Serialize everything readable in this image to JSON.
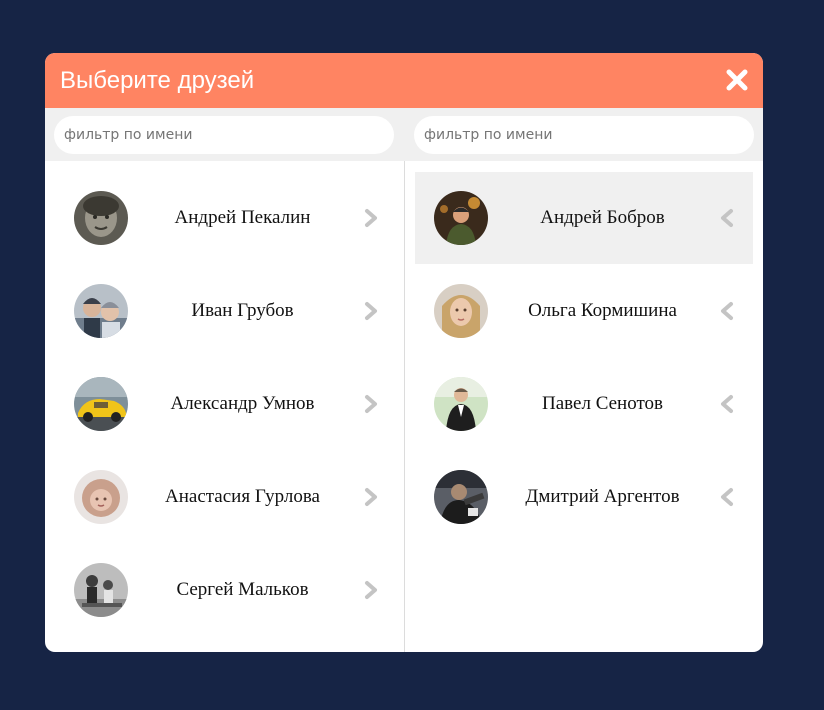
{
  "dialog": {
    "title": "Выберите друзей",
    "close_icon": "close-icon",
    "accent_color": "#ff8462",
    "background_color": "#162445"
  },
  "filters": {
    "left_placeholder": "фильтр по имени",
    "left_value": "",
    "right_placeholder": "фильтр по имени",
    "right_value": ""
  },
  "available_friends": [
    {
      "name": "Андрей Пекалин",
      "icon": "chevron-right-icon"
    },
    {
      "name": "Иван Грубов",
      "icon": "chevron-right-icon"
    },
    {
      "name": "Александр Умнов",
      "icon": "chevron-right-icon"
    },
    {
      "name": "Анастасия Гурлова",
      "icon": "chevron-right-icon"
    },
    {
      "name": "Сергей Мальков",
      "icon": "chevron-right-icon"
    }
  ],
  "selected_friends": [
    {
      "name": "Андрей Бобров",
      "icon": "chevron-left-icon",
      "highlighted": true
    },
    {
      "name": "Ольга Кормишина",
      "icon": "chevron-left-icon",
      "highlighted": false
    },
    {
      "name": "Павел Сенотов",
      "icon": "chevron-left-icon",
      "highlighted": false
    },
    {
      "name": "Дмитрий Аргентов",
      "icon": "chevron-left-icon",
      "highlighted": false
    }
  ]
}
